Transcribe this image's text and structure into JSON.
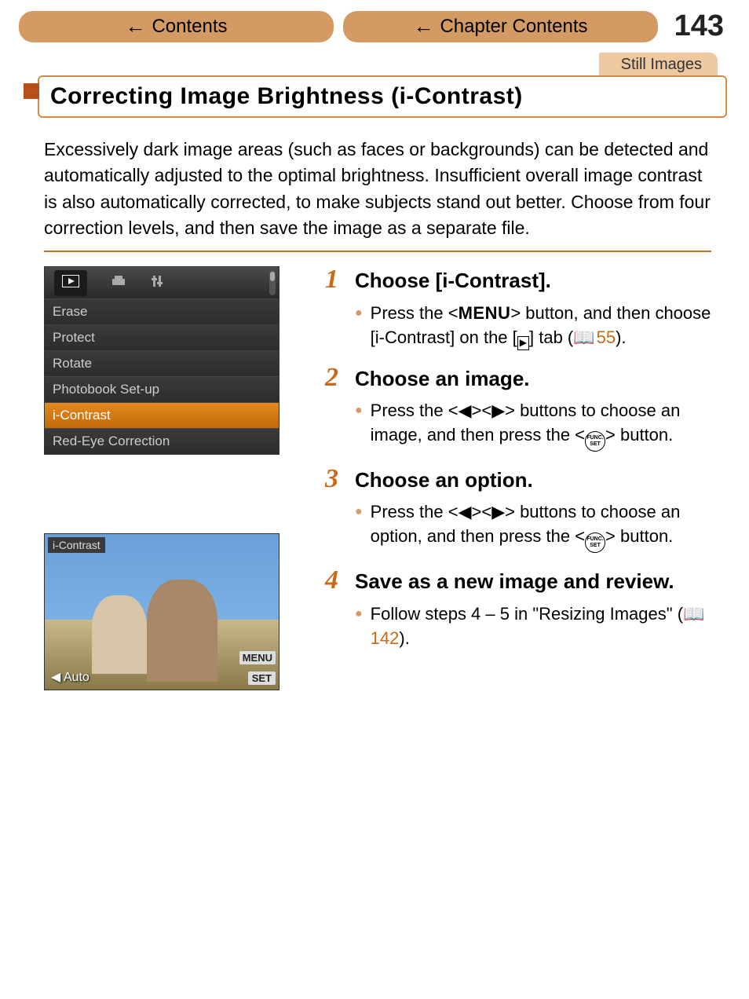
{
  "nav": {
    "contents": "Contents",
    "chapter_contents": "Chapter Contents",
    "page_number": "143"
  },
  "tag": "Still Images",
  "title": "Correcting Image Brightness (i-Contrast)",
  "intro": "Excessively dark image areas (such as faces or backgrounds) can be detected and automatically adjusted to the optimal brightness. Insufficient overall image contrast is also automatically corrected, to make subjects stand out better. Choose from four correction levels, and then save the image as a separate file.",
  "camera_menu": {
    "items": [
      "Erase",
      "Protect",
      "Rotate",
      "Photobook Set-up",
      "i-Contrast",
      "Red-Eye Correction"
    ],
    "selected_index": 4
  },
  "preview": {
    "label": "i-Contrast",
    "option_left": "Auto",
    "menu_btn": "MENU",
    "set_btn": "SET"
  },
  "steps": [
    {
      "num": "1",
      "title": "Choose [i-Contrast].",
      "body_pre": "Press the <",
      "body_btn": "MENU",
      "body_mid": "> button, and then choose [i-Contrast] on the [",
      "body_playicon": "▶",
      "body_post": "] tab (",
      "body_ref": "55",
      "body_end": ")."
    },
    {
      "num": "2",
      "title": "Choose an image.",
      "body_pre": "Press the <",
      "body_left": "◀",
      "body_sep": "><",
      "body_right": "▶",
      "body_mid": "> buttons to choose an image, and then press the <",
      "func_top": "FUNC.",
      "func_bot": "SET",
      "body_end": "> button."
    },
    {
      "num": "3",
      "title": "Choose an option.",
      "body_pre": "Press the <",
      "body_left": "◀",
      "body_sep": "><",
      "body_right": "▶",
      "body_mid": "> buttons to choose an option, and then press the <",
      "func_top": "FUNC.",
      "func_bot": "SET",
      "body_end": "> button."
    },
    {
      "num": "4",
      "title": "Save as a new image and review.",
      "body_pre": "Follow steps 4 – 5 in \"Resizing Images\" (",
      "body_ref": "142",
      "body_end": ")."
    }
  ]
}
